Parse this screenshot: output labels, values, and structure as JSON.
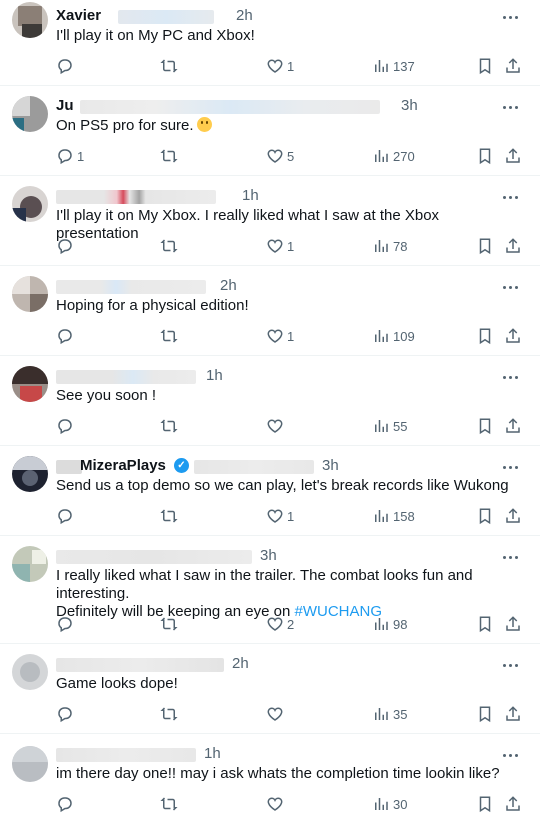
{
  "replies": [
    {
      "name": "Xavier",
      "time": "2h",
      "text": "I'll play it on My PC and Xbox!",
      "replies": "",
      "likes": "1",
      "views": "137"
    },
    {
      "name": "Ju",
      "time": "3h",
      "text": "On PS5 pro for sure.",
      "replies": "1",
      "likes": "5",
      "views": "270"
    },
    {
      "name": "",
      "time": "1h",
      "text": "I'll play it on My Xbox. I really liked what I saw at the Xbox presentation",
      "replies": "",
      "likes": "1",
      "views": "78"
    },
    {
      "name": "",
      "time": "2h",
      "text": "Hoping for a physical edition!",
      "replies": "",
      "likes": "1",
      "views": "109"
    },
    {
      "name": "",
      "time": "1h",
      "text": "See you soon !",
      "replies": "",
      "likes": "",
      "views": "55"
    },
    {
      "name": "MizeraPlays",
      "time": "3h",
      "text": "Send us a top demo so we can play, let's break records like Wukong",
      "replies": "",
      "likes": "1",
      "views": "158"
    },
    {
      "name": "",
      "time": "3h",
      "text_line1": "I really liked what I saw in the trailer. The combat looks fun and interesting.",
      "text_line2": "Definitely will be keeping an eye on",
      "hashtag": "#WUCHANG",
      "replies": "",
      "likes": "2",
      "views": "98"
    },
    {
      "name": "",
      "time": "2h",
      "text": "Game looks dope!",
      "replies": "",
      "likes": "",
      "views": "35"
    },
    {
      "name": "",
      "time": "1h",
      "text": "im there day one!! may i ask whats the completion time lookin like?",
      "replies": "",
      "likes": "",
      "views": "30"
    }
  ],
  "icons": {
    "reply": "reply-icon",
    "retweet": "retweet-icon",
    "like": "heart-icon",
    "views": "views-icon",
    "bookmark": "bookmark-icon",
    "share": "share-icon",
    "more": "more-icon",
    "verified": "verified-badge-icon"
  },
  "colors": {
    "text": "#0f1419",
    "muted": "#536471",
    "link": "#1d9bf0",
    "divider": "#eff3f4"
  }
}
